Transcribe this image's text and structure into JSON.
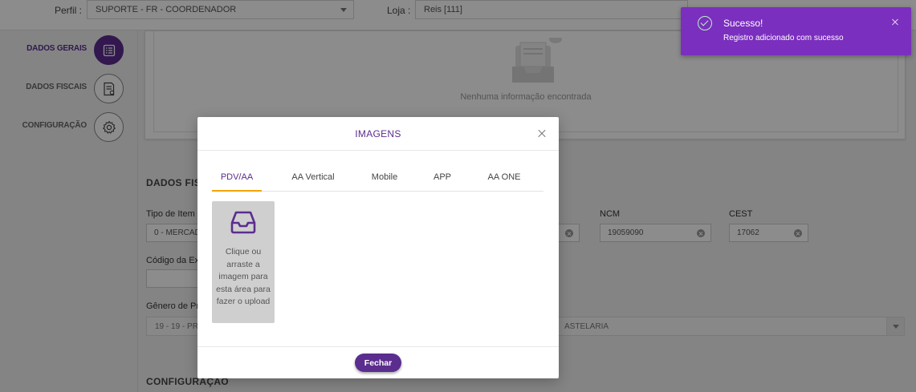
{
  "topbar": {
    "perfil_label": "Perfil :",
    "perfil_value": "SUPORTE - FR - COORDENADOR",
    "loja_label": "Loja :",
    "loja_value": "Reis [111]"
  },
  "sidebar": {
    "items": [
      {
        "label": "DADOS GERAIS",
        "icon": "list-icon",
        "active": true
      },
      {
        "label": "DADOS FISCAIS",
        "icon": "document-icon",
        "active": false
      },
      {
        "label": "CONFIGURAÇÃO",
        "icon": "gear-icon",
        "active": false
      }
    ]
  },
  "main": {
    "empty_text": "Nenhuma informação encontrada",
    "section_fiscal": "DADOS FISC",
    "tipo_item_label": "Tipo de Item",
    "tipo_item_value": "0 - MERCAD",
    "ncm_label": "NCM",
    "ncm_value": "19059090",
    "cest_label": "CEST",
    "cest_value": "17062",
    "codigo_exc_label": "Código da Exc",
    "genero_label": "Gênero de Pro",
    "genero_value_left": "19 - 19 - PR",
    "genero_value_right": "ASTELARIA",
    "section_config": "CONFIGURAÇÃO"
  },
  "modal": {
    "title": "IMAGENS",
    "tabs": [
      {
        "label": "PDV/AA",
        "active": true
      },
      {
        "label": "AA Vertical",
        "active": false
      },
      {
        "label": "Mobile",
        "active": false
      },
      {
        "label": "APP",
        "active": false
      },
      {
        "label": "AA ONE",
        "active": false
      }
    ],
    "upload_text": "Clique ou arraste a imagem para esta área para fazer o upload",
    "close_button": "Fechar"
  },
  "toast": {
    "title": "Sucesso!",
    "message": "Registro adicionado com sucesso"
  },
  "colors": {
    "brand_purple": "#5b2d8e",
    "toast_purple": "#7b2fbe",
    "tab_underline": "#f0a500"
  }
}
